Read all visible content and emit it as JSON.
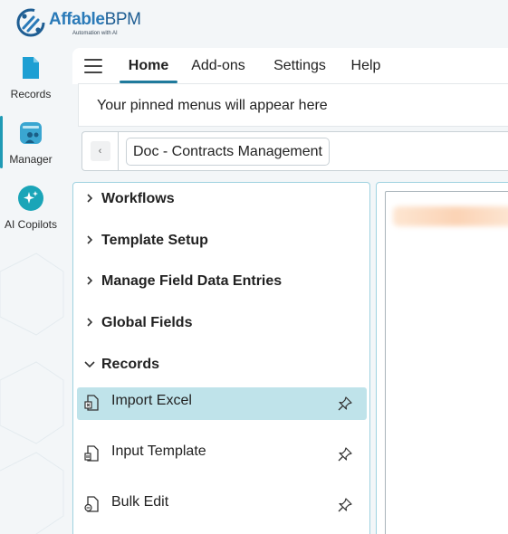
{
  "brand": {
    "name_part1": "Affable",
    "name_part2": "BPM",
    "tagline": "Automation with AI",
    "primary_color": "#2a7ab8",
    "accent_color": "#1f9ab5"
  },
  "rail": {
    "items": [
      {
        "label": "Records",
        "icon": "records-icon",
        "active": false
      },
      {
        "label": "Manager",
        "icon": "manager-icon",
        "active": true
      },
      {
        "label": "AI Copilots",
        "icon": "ai-copilots-icon",
        "active": false
      }
    ]
  },
  "topnav": {
    "menu_icon": "hamburger-icon",
    "tabs": [
      {
        "label": "Home",
        "active": true
      },
      {
        "label": "Add-ons",
        "active": false
      },
      {
        "label": "Settings",
        "active": false
      },
      {
        "label": "Help",
        "active": false
      }
    ]
  },
  "pinned": {
    "message": "Your pinned menus will appear here"
  },
  "breadcrumb": {
    "back_icon": "chevron-left-icon",
    "current": "Doc - Contracts Management"
  },
  "nav": {
    "sections": [
      {
        "label": "Workflows",
        "expanded": false
      },
      {
        "label": "Template Setup",
        "expanded": false
      },
      {
        "label": "Manage Field Data Entries",
        "expanded": false
      },
      {
        "label": "Global Fields",
        "expanded": false
      },
      {
        "label": "Records",
        "expanded": true
      }
    ],
    "items": [
      {
        "label": "Import Excel",
        "icon": "import-excel-icon",
        "selected": true
      },
      {
        "label": "Input Template",
        "icon": "input-template-icon",
        "selected": false
      },
      {
        "label": "Bulk Edit",
        "icon": "bulk-edit-icon",
        "selected": false
      }
    ]
  }
}
